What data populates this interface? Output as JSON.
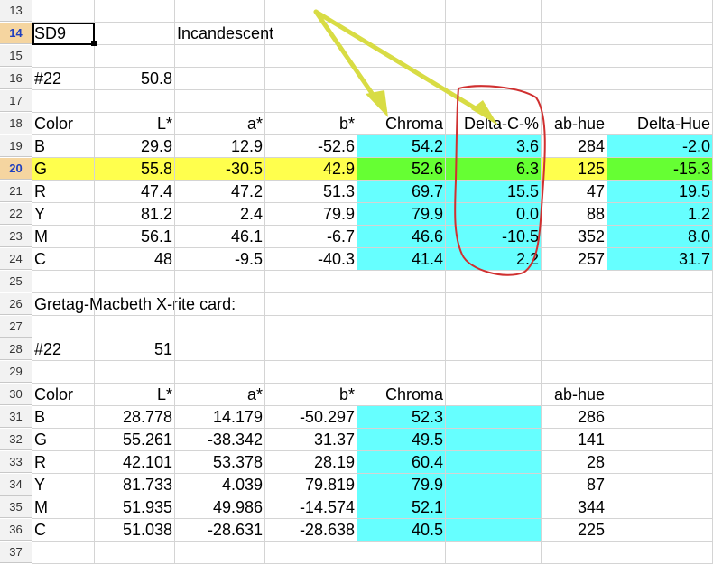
{
  "colors": {
    "cyan": "#66ffff",
    "row_highlight": "#ffff4d",
    "green_highlight": "#66ff33",
    "arrow": "#d8dc44",
    "circle": "#d03030"
  },
  "rows": [
    {
      "num": "13",
      "cells": []
    },
    {
      "num": "14",
      "selected": true,
      "cells": [
        "SD9",
        "",
        "Incandescent"
      ]
    },
    {
      "num": "15",
      "cells": []
    },
    {
      "num": "16",
      "cells": [
        "#22",
        "50.8"
      ]
    },
    {
      "num": "17",
      "cells": []
    },
    {
      "num": "18",
      "cells": [
        "Color",
        "L*",
        "a*",
        "b*",
        "Chroma",
        "Delta-C-%",
        "ab-hue",
        "Delta-Hue"
      ]
    },
    {
      "num": "19",
      "cells": [
        "B",
        "29.9",
        "12.9",
        "-52.6",
        "54.2",
        "3.6",
        "284",
        "-2.0"
      ]
    },
    {
      "num": "20",
      "selected": true,
      "highlight": true,
      "cells": [
        "G",
        "55.8",
        "-30.5",
        "42.9",
        "52.6",
        "6.3",
        "125",
        "-15.3"
      ]
    },
    {
      "num": "21",
      "cells": [
        "R",
        "47.4",
        "47.2",
        "51.3",
        "69.7",
        "15.5",
        "47",
        "19.5"
      ]
    },
    {
      "num": "22",
      "cells": [
        "Y",
        "81.2",
        "2.4",
        "79.9",
        "79.9",
        "0.0",
        "88",
        "1.2"
      ]
    },
    {
      "num": "23",
      "cells": [
        "M",
        "56.1",
        "46.1",
        "-6.7",
        "46.6",
        "-10.5",
        "352",
        "8.0"
      ]
    },
    {
      "num": "24",
      "cells": [
        "C",
        "48",
        "-9.5",
        "-40.3",
        "41.4",
        "2.2",
        "257",
        "31.7"
      ]
    },
    {
      "num": "25",
      "cells": []
    },
    {
      "num": "26",
      "cells": [
        "Gretag-Macbeth X-rite card:"
      ]
    },
    {
      "num": "27",
      "cells": []
    },
    {
      "num": "28",
      "cells": [
        "#22",
        "51"
      ]
    },
    {
      "num": "29",
      "cells": []
    },
    {
      "num": "30",
      "cells": [
        "Color",
        "L*",
        "a*",
        "b*",
        "Chroma",
        "",
        "ab-hue"
      ]
    },
    {
      "num": "31",
      "cells": [
        "B",
        "28.778",
        "14.179",
        "-50.297",
        "52.3",
        "",
        "286"
      ]
    },
    {
      "num": "32",
      "cells": [
        "G",
        "55.261",
        "-38.342",
        "31.37",
        "49.5",
        "",
        "141"
      ]
    },
    {
      "num": "33",
      "cells": [
        "R",
        "42.101",
        "53.378",
        "28.19",
        "60.4",
        "",
        "28"
      ]
    },
    {
      "num": "34",
      "cells": [
        "Y",
        "81.733",
        "4.039",
        "79.819",
        "79.9",
        "",
        "87"
      ]
    },
    {
      "num": "35",
      "cells": [
        "M",
        "51.935",
        "49.986",
        "-14.574",
        "52.1",
        "",
        "344"
      ]
    },
    {
      "num": "36",
      "cells": [
        "C",
        "51.038",
        "-28.631",
        "-28.638",
        "40.5",
        "",
        "225"
      ]
    },
    {
      "num": "37",
      "cells": []
    }
  ]
}
